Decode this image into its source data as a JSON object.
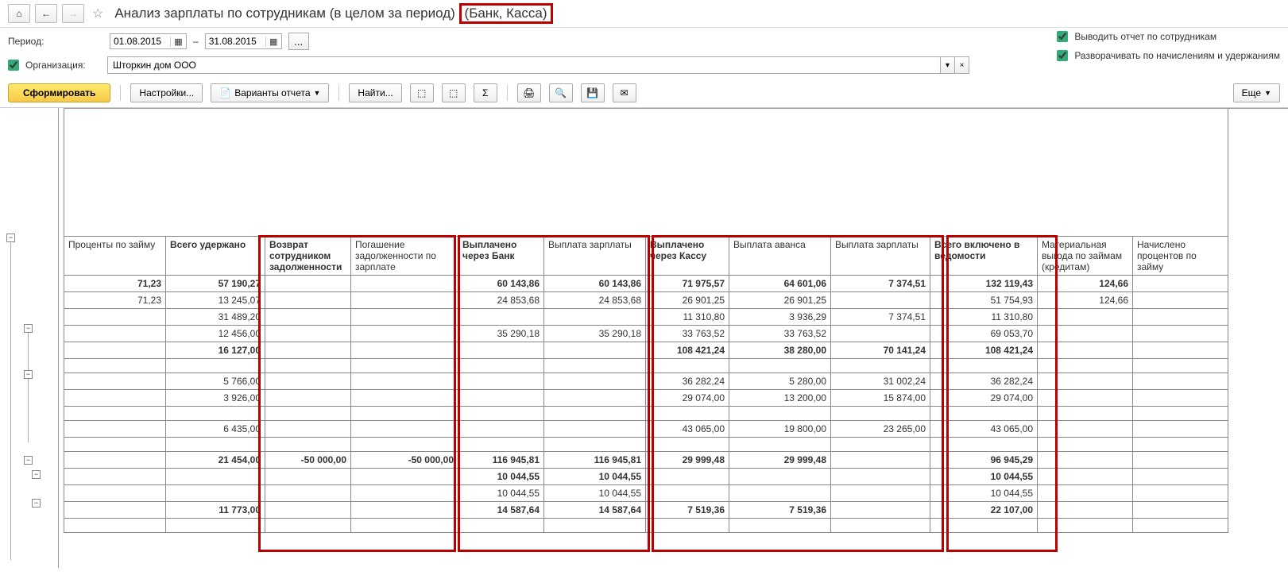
{
  "header": {
    "title_main": "Анализ зарплаты по сотрудникам (в целом за период)",
    "title_suffix": "(Банк, Касса)"
  },
  "filters": {
    "period_label": "Период:",
    "date_from": "01.08.2015",
    "date_sep": "–",
    "date_to": "31.08.2015",
    "org_label": "Организация:",
    "org_value": "Шторкин дом ООО",
    "opt1": "Выводить отчет по сотрудникам",
    "opt2": "Разворачивать по начислениям и удержаниям"
  },
  "actions": {
    "generate": "Сформировать",
    "settings": "Настройки...",
    "variants": "Варианты отчета",
    "find": "Найти...",
    "more": "Еще"
  },
  "table": {
    "headers": [
      "Проценты по займу",
      "Всего удержано",
      "Возврат сотрудником задолженности",
      "Погашение задолженности по зарплате",
      "Выплачено через Банк",
      "Выплата зарплаты",
      "Выплачено через Кассу",
      "Выплата аванса",
      "Выплата зарплаты",
      "Всего включено в ведомости",
      "Материальная выгода по займам (кредитам)",
      "Начислено процентов по займу"
    ],
    "rows": [
      {
        "bold": true,
        "cells": [
          "71,23",
          "57 190,27",
          "",
          "",
          "60 143,86",
          "60 143,86",
          "71 975,57",
          "64 601,06",
          "7 374,51",
          "132 119,43",
          "124,66",
          ""
        ]
      },
      {
        "cells": [
          "71,23",
          "13 245,07",
          "",
          "",
          "24 853,68",
          "24 853,68",
          "26 901,25",
          "26 901,25",
          "",
          "51 754,93",
          "124,66",
          ""
        ]
      },
      {
        "cells": [
          "",
          "31 489,20",
          "",
          "",
          "",
          "",
          "11 310,80",
          "3 936,29",
          "7 374,51",
          "11 310,80",
          "",
          ""
        ]
      },
      {
        "cells": [
          "",
          "12 456,00",
          "",
          "",
          "35 290,18",
          "35 290,18",
          "33 763,52",
          "33 763,52",
          "",
          "69 053,70",
          "",
          ""
        ]
      },
      {
        "bold": true,
        "cells": [
          "",
          "16 127,00",
          "",
          "",
          "",
          "",
          "108 421,24",
          "38 280,00",
          "70 141,24",
          "108 421,24",
          "",
          ""
        ]
      },
      {
        "cells": [
          "",
          "",
          "",
          "",
          "",
          "",
          "",
          "",
          "",
          "",
          "",
          ""
        ]
      },
      {
        "cells": [
          "",
          "5 766,00",
          "",
          "",
          "",
          "",
          "36 282,24",
          "5 280,00",
          "31 002,24",
          "36 282,24",
          "",
          ""
        ]
      },
      {
        "cells": [
          "",
          "3 926,00",
          "",
          "",
          "",
          "",
          "29 074,00",
          "13 200,00",
          "15 874,00",
          "29 074,00",
          "",
          ""
        ]
      },
      {
        "cells": [
          "",
          "",
          "",
          "",
          "",
          "",
          "",
          "",
          "",
          "",
          "",
          ""
        ]
      },
      {
        "cells": [
          "",
          "6 435,00",
          "",
          "",
          "",
          "",
          "43 065,00",
          "19 800,00",
          "23 265,00",
          "43 065,00",
          "",
          ""
        ]
      },
      {
        "cells": [
          "",
          "",
          "",
          "",
          "",
          "",
          "",
          "",
          "",
          "",
          "",
          ""
        ]
      },
      {
        "bold": true,
        "cells": [
          "",
          "21 454,00",
          "-50 000,00",
          "-50 000,00",
          "116 945,81",
          "116 945,81",
          "29 999,48",
          "29 999,48",
          "",
          "96 945,29",
          "",
          ""
        ]
      },
      {
        "bold": true,
        "cells": [
          "",
          "",
          "",
          "",
          "10 044,55",
          "10 044,55",
          "",
          "",
          "",
          "10 044,55",
          "",
          ""
        ]
      },
      {
        "cells": [
          "",
          "",
          "",
          "",
          "10 044,55",
          "10 044,55",
          "",
          "",
          "",
          "10 044,55",
          "",
          ""
        ]
      },
      {
        "bold": true,
        "cells": [
          "",
          "11 773,00",
          "",
          "",
          "14 587,64",
          "14 587,64",
          "7 519,36",
          "7 519,36",
          "",
          "22 107,00",
          "",
          ""
        ]
      },
      {
        "cells": [
          "",
          "",
          "",
          "",
          "",
          "",
          "",
          "",
          "",
          "",
          "",
          ""
        ]
      }
    ]
  }
}
